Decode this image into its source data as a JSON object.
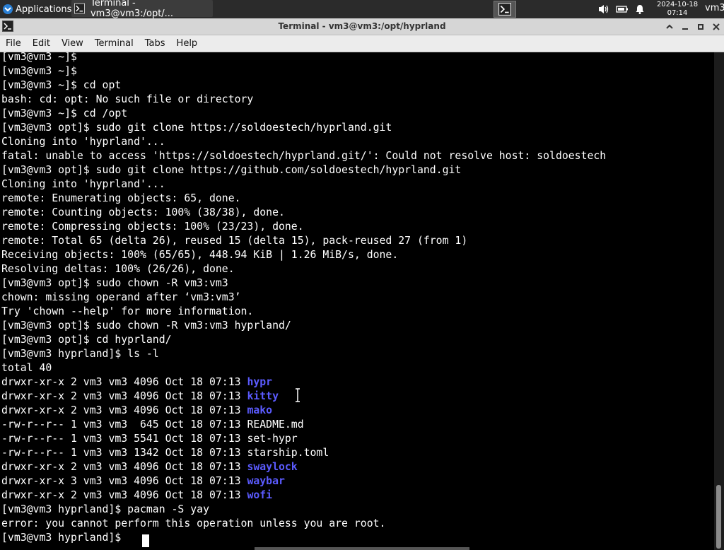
{
  "panel": {
    "applications_label": "Applications",
    "task_title": "Terminal - vm3@vm3:/opt/...",
    "clock_date": "2024-10-18",
    "clock_time": "07:14",
    "user": "vm3"
  },
  "window": {
    "title": "Terminal - vm3@vm3:/opt/hyprland"
  },
  "menubar": {
    "items": [
      "File",
      "Edit",
      "View",
      "Terminal",
      "Tabs",
      "Help"
    ]
  },
  "terminal": {
    "lines": [
      "[vm3@vm3 ~]$",
      "[vm3@vm3 ~]$",
      "[vm3@vm3 ~]$ cd opt",
      "bash: cd: opt: No such file or directory",
      "[vm3@vm3 ~]$ cd /opt",
      "[vm3@vm3 opt]$ sudo git clone https://soldoestech/hyprland.git",
      "Cloning into 'hyprland'...",
      "fatal: unable to access 'https://soldoestech/hyprland.git/': Could not resolve host: soldoestech",
      "[vm3@vm3 opt]$ sudo git clone https://github.com/soldoestech/hyprland.git",
      "Cloning into 'hyprland'...",
      "remote: Enumerating objects: 65, done.",
      "remote: Counting objects: 100% (38/38), done.",
      "remote: Compressing objects: 100% (23/23), done.",
      "remote: Total 65 (delta 26), reused 15 (delta 15), pack-reused 27 (from 1)",
      "Receiving objects: 100% (65/65), 448.94 KiB | 1.26 MiB/s, done.",
      "Resolving deltas: 100% (26/26), done.",
      "[vm3@vm3 opt]$ sudo chown -R vm3:vm3",
      "chown: missing operand after ‘vm3:vm3’",
      "Try 'chown --help' for more information.",
      "[vm3@vm3 opt]$ sudo chown -R vm3:vm3 hyprland/",
      "[vm3@vm3 opt]$ cd hyprland/",
      "[vm3@vm3 hyprland]$ ls -l",
      "total 40"
    ],
    "listing": [
      {
        "meta": "drwxr-xr-x 2 vm3 vm3 4096 Oct 18 07:13 ",
        "name": "hypr",
        "is_dir": true
      },
      {
        "meta": "drwxr-xr-x 2 vm3 vm3 4096 Oct 18 07:13 ",
        "name": "kitty",
        "is_dir": true
      },
      {
        "meta": "drwxr-xr-x 2 vm3 vm3 4096 Oct 18 07:13 ",
        "name": "mako",
        "is_dir": true
      },
      {
        "meta": "-rw-r--r-- 1 vm3 vm3  645 Oct 18 07:13 ",
        "name": "README.md",
        "is_dir": false
      },
      {
        "meta": "-rw-r--r-- 1 vm3 vm3 5541 Oct 18 07:13 ",
        "name": "set-hypr",
        "is_dir": false
      },
      {
        "meta": "-rw-r--r-- 1 vm3 vm3 1342 Oct 18 07:13 ",
        "name": "starship.toml",
        "is_dir": false
      },
      {
        "meta": "drwxr-xr-x 2 vm3 vm3 4096 Oct 18 07:13 ",
        "name": "swaylock",
        "is_dir": true
      },
      {
        "meta": "drwxr-xr-x 3 vm3 vm3 4096 Oct 18 07:13 ",
        "name": "waybar",
        "is_dir": true
      },
      {
        "meta": "drwxr-xr-x 2 vm3 vm3 4096 Oct 18 07:13 ",
        "name": "wofi",
        "is_dir": true
      }
    ],
    "tail_lines": [
      "[vm3@vm3 hyprland]$ pacman -S yay",
      "error: you cannot perform this operation unless you are root.",
      "[vm3@vm3 hyprland]$ "
    ]
  },
  "colors": {
    "directory": "#5b5bff",
    "foreground": "#ffffff",
    "background": "#000000"
  }
}
